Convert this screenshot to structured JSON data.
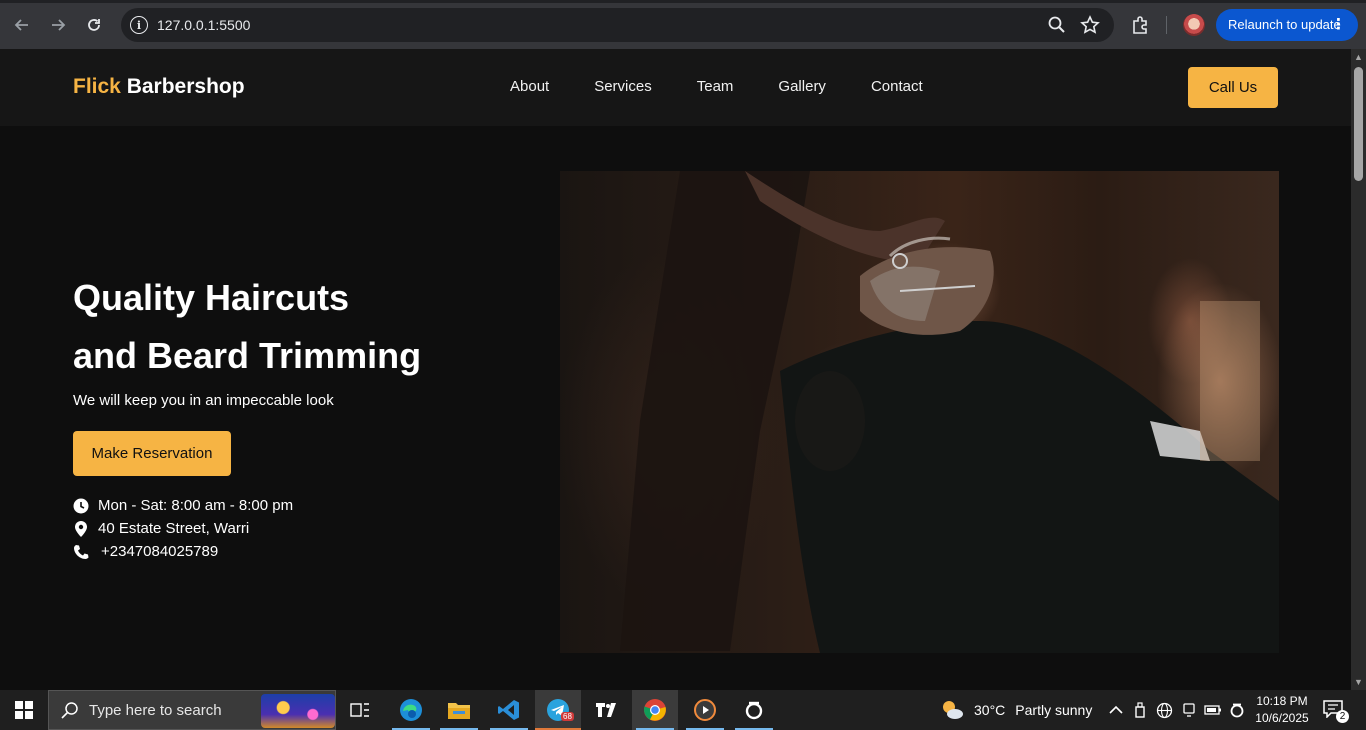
{
  "browser": {
    "url": "127.0.0.1:5500",
    "relaunch_label": "Relaunch to update"
  },
  "site": {
    "logo_accent": "Flick",
    "logo_main": " Barbershop",
    "nav": [
      "About",
      "Services",
      "Team",
      "Gallery",
      "Contact"
    ],
    "call_label": "Call Us",
    "hero_title_line1": "Quality Haircuts",
    "hero_title_line2": "and Beard Trimming",
    "hero_subtitle": "We will keep you in an impeccable look",
    "reserve_label": "Make Reservation",
    "hours": "Mon - Sat: 8:00 am - 8:00 pm",
    "address": "40 Estate Street, Warri",
    "phone": "+2347084025789",
    "accent_color": "#f6b444"
  },
  "taskbar": {
    "search_placeholder": "Type here to search",
    "telegram_badge": "68",
    "temperature": "30°C",
    "weather_condition": "Partly sunny",
    "time": "10:18 PM",
    "date": "10/6/2025",
    "notification_count": "2",
    "apps": [
      "task-view-icon",
      "edge-icon",
      "file-explorer-icon",
      "vscode-icon",
      "telegram-icon",
      "tradingview-icon",
      "chrome-icon",
      "media-player-icon",
      "openai-icon"
    ]
  }
}
